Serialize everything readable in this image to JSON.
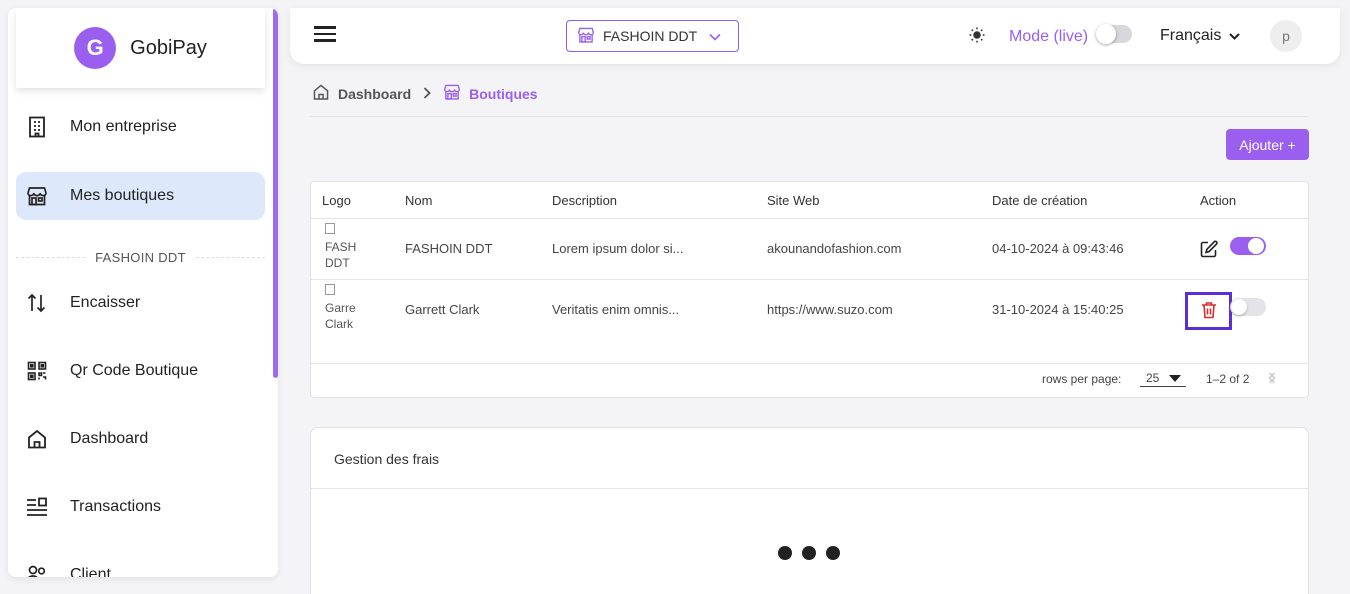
{
  "brand": {
    "name": "GobiPay",
    "logo_letter": "G"
  },
  "sidebar": {
    "items": [
      {
        "label": "Mon entreprise",
        "icon": "building-icon",
        "active": false
      },
      {
        "label": "Mes boutiques",
        "icon": "store-icon",
        "active": true
      },
      {
        "label": "Encaisser",
        "icon": "arrows-updown-icon",
        "active": false
      },
      {
        "label": "Qr Code Boutique",
        "icon": "qrcode-icon",
        "active": false
      },
      {
        "label": "Dashboard",
        "icon": "home-icon",
        "active": false
      },
      {
        "label": "Transactions",
        "icon": "transactions-icon",
        "active": false
      },
      {
        "label": "Client",
        "icon": "users-icon",
        "active": false
      }
    ],
    "section_label": "FASHOIN DDT"
  },
  "header": {
    "shop_select": "FASHOIN DDT",
    "mode_label": "Mode (live)",
    "language": "Français",
    "avatar_letter": "p"
  },
  "breadcrumb": {
    "home": "Dashboard",
    "current": "Boutiques"
  },
  "add_button": "Ajouter +",
  "table": {
    "headers": [
      "Logo",
      "Nom",
      "Description",
      "Site Web",
      "Date de création",
      "Action"
    ],
    "rows": [
      {
        "logo_alt": "FASH DDT",
        "logo_alt_lines": [
          "FASH",
          "DDT"
        ],
        "name": "FASHOIN DDT",
        "description": "Lorem ipsum dolor si...",
        "website": "akounandofashion.com",
        "date": "04-10-2024 à 09:43:46",
        "active": true
      },
      {
        "logo_alt": "Garre Clark",
        "logo_alt_lines": [
          "Garre",
          "Clark"
        ],
        "name": "Garrett Clark",
        "description": "Veritatis enim omnis...",
        "website": "https://www.suzo.com",
        "date": "31-10-2024 à 15:40:25",
        "active": false
      }
    ],
    "pagination": {
      "rows_per_page_label": "rows per page:",
      "rows_per_page": "25",
      "range": "1–2 of 2"
    }
  },
  "frais": {
    "title": "Gestion des frais"
  },
  "colors": {
    "accent": "#9b5ff0",
    "active_nav_bg": "#dde9fb",
    "delete": "#d32f2f"
  }
}
